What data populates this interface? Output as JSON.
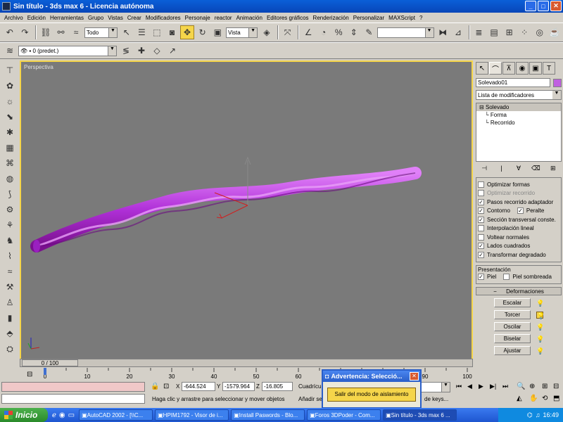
{
  "window": {
    "title": "Sin título - 3ds max 6 - Licencia autónoma"
  },
  "menu": [
    "Archivo",
    "Edición",
    "Herramientas",
    "Grupo",
    "Vistas",
    "Crear",
    "Modificadores",
    "Personaje",
    "reactor",
    "Animación",
    "Editores gráficos",
    "Renderización",
    "Personalizar",
    "MAXScript",
    "?"
  ],
  "toolbar": {
    "selection_filter": "Todo",
    "reference_coord": "Vista",
    "layer_value": "0 (predet.)"
  },
  "viewport": {
    "label": "Perspectiva"
  },
  "timeline": {
    "frame_label": "0 / 100",
    "ticks": [
      "0",
      "10",
      "20",
      "30",
      "40",
      "50",
      "60",
      "70",
      "80",
      "90",
      "100"
    ]
  },
  "command_panel": {
    "object_name": "Solevado01",
    "object_color": "#c060e0",
    "modifier_list": "Lista de modificadores",
    "stack": [
      {
        "label": "Solevado",
        "selected": true,
        "sub": false
      },
      {
        "label": "Forma",
        "selected": false,
        "sub": true
      },
      {
        "label": "Recorrido",
        "selected": false,
        "sub": true
      }
    ],
    "options": [
      {
        "label": "Optimizar formas",
        "checked": false,
        "disabled": false
      },
      {
        "label": "Optimizar recorrido",
        "checked": false,
        "disabled": true
      },
      {
        "label": "Pasos recorrido adaptador",
        "checked": true,
        "disabled": false
      },
      {
        "label": "Contorno",
        "checked": true,
        "disabled": false,
        "pair": "Peralte",
        "pair_checked": true
      },
      {
        "label": "Sección transversal conste.",
        "checked": true,
        "disabled": false
      },
      {
        "label": "Interpolación lineal",
        "checked": false,
        "disabled": false
      },
      {
        "label": "Voltear normales",
        "checked": false,
        "disabled": false
      },
      {
        "label": "Lados cuadrados",
        "checked": true,
        "disabled": false
      },
      {
        "label": "Transformar degradado",
        "checked": true,
        "disabled": false
      }
    ],
    "presentation": {
      "header": "Presentación",
      "skin": "Piel",
      "skin_checked": true,
      "skin_shaded": "Piel sombreada",
      "skin_shaded_checked": false
    },
    "deformations_header": "Deformaciones",
    "deformations": [
      {
        "label": "Escalar",
        "active": false
      },
      {
        "label": "Torcer",
        "active": true
      },
      {
        "label": "Oscilar",
        "active": false
      },
      {
        "label": "Biselar",
        "active": false
      },
      {
        "label": "Ajustar",
        "active": false
      }
    ]
  },
  "status": {
    "x": "-644.524",
    "y": "-1579.964",
    "z": "-16.805",
    "grid_label": "Cuadrícul",
    "prompt": "Haga clic y arrastre para seleccionar y mover objetos",
    "add_label": "Añadir se",
    "keys_label": "de keys..."
  },
  "dialog": {
    "title": "Advertencia: Selecció...",
    "button": "Salir del modo de aislamiento"
  },
  "taskbar": {
    "start": "Inicio",
    "tasks": [
      {
        "label": "AutoCAD 2002 - [\\\\C...",
        "active": false
      },
      {
        "label": "HPIM1792 - Visor de i...",
        "active": false
      },
      {
        "label": "Install Paswords - Blo...",
        "active": false
      },
      {
        "label": "Foros 3DPoder - Com...",
        "active": false
      },
      {
        "label": "Sin título - 3ds max 6 ...",
        "active": true
      }
    ],
    "clock": "16:49"
  }
}
